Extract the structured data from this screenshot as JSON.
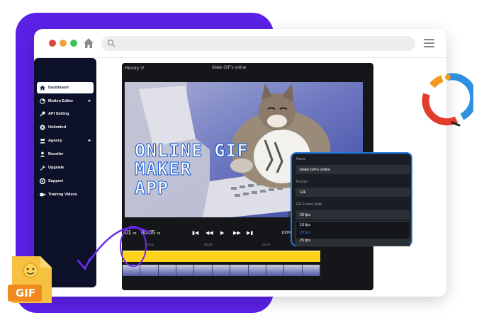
{
  "browser": {
    "traffic_lights": [
      "#e5443b",
      "#f1a43b",
      "#3bc24f"
    ]
  },
  "sidebar": {
    "items": [
      {
        "label": "Dashboard",
        "icon": "home-icon",
        "active": true,
        "chevron": false
      },
      {
        "label": "Motion Editor",
        "icon": "motion-icon",
        "active": false,
        "chevron": true
      },
      {
        "label": "API Setting",
        "icon": "key-icon",
        "active": false,
        "chevron": false
      },
      {
        "label": "Unlimited",
        "icon": "unlimited-icon",
        "active": false,
        "chevron": false
      },
      {
        "label": "Agency",
        "icon": "people-icon",
        "active": false,
        "chevron": true
      },
      {
        "label": "Reseller",
        "icon": "person-icon",
        "active": false,
        "chevron": false
      },
      {
        "label": "Upgrade",
        "icon": "wrench-icon",
        "active": false,
        "chevron": false
      },
      {
        "label": "Support",
        "icon": "support-icon",
        "active": false,
        "chevron": false
      },
      {
        "label": "Training Videos",
        "icon": "video-icon",
        "active": false,
        "chevron": false
      }
    ]
  },
  "editor": {
    "history_label": "History",
    "title": "Make GIF's online",
    "gif_text_lines": [
      "ONLINE GIF",
      "MAKER",
      "APP"
    ],
    "timecode_current": ":01",
    "timecode_current_frames": "00",
    "timecode_total": "00:05",
    "timecode_total_frames": "00",
    "zoom": "100%",
    "ruler_labels": [
      "00:02",
      "00:03",
      "00:04"
    ]
  },
  "panel": {
    "name_label": "Name",
    "name_value": "Make GIFs online",
    "format_label": "Format",
    "format_value": "GIF",
    "frame_rate_label": "GIF Frame Rate",
    "frame_rate_value": "20 fps",
    "frame_rate_options": [
      "10 fps",
      "20 fps",
      "25 fps"
    ],
    "highlighted_option": "20 fps"
  },
  "file_badge": "GIF",
  "colors": {
    "purple": "#5b21e6",
    "sidebar": "#0c1028",
    "accent_blue": "#2376e0",
    "track_yellow": "#ffd21a"
  }
}
